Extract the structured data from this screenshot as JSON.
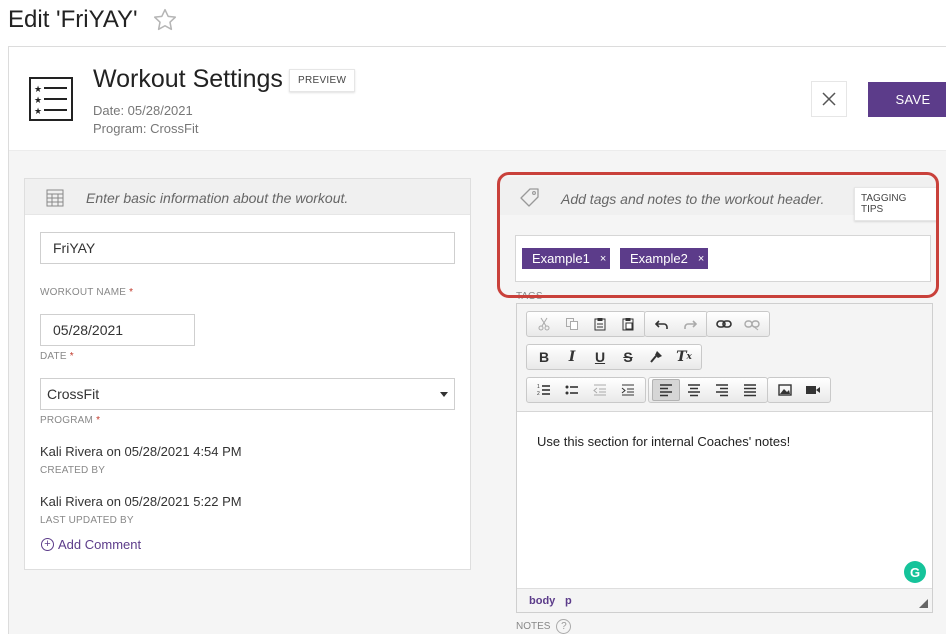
{
  "page": {
    "title": "Edit 'FriYAY'"
  },
  "header": {
    "title": "Workout Settings",
    "preview_label": "PREVIEW",
    "date_line": "Date: 05/28/2021",
    "program_line": "Program: CrossFit",
    "save_label": "SAVE"
  },
  "basic": {
    "heading": "Enter basic information about the workout.",
    "workout_name": {
      "value": "FriYAY",
      "label": "WORKOUT NAME",
      "required": "*"
    },
    "date": {
      "value": "05/28/2021",
      "label": "DATE",
      "required": "*"
    },
    "program": {
      "value": "CrossFit",
      "label": "PROGRAM",
      "required": "*"
    },
    "created": {
      "value": "Kali Rivera on 05/28/2021 4:54 PM",
      "label": "CREATED BY"
    },
    "updated": {
      "value": "Kali Rivera on 05/28/2021 5:22 PM",
      "label": "LAST UPDATED BY"
    },
    "add_comment": "Add Comment"
  },
  "tags": {
    "heading": "Add tags and notes to the workout header.",
    "tips_label": "TAGGING TIPS",
    "items": [
      "Example1",
      "Example2"
    ],
    "remove_glyph": "×",
    "label": "TAGS"
  },
  "notes": {
    "content": "Use this section for internal Coaches' notes!",
    "path": [
      "body",
      "p"
    ],
    "label": "NOTES",
    "help_glyph": "?",
    "grammarly_glyph": "G"
  },
  "colors": {
    "accent": "#5c3c8a",
    "highlight_outline": "#c9413b",
    "grammarly": "#15c39a"
  },
  "icons": {
    "favorite": "star-outline-icon",
    "document": "checklist-icon",
    "calendar": "calendar-grid-icon",
    "tag": "tag-icon",
    "close": "close-icon"
  }
}
